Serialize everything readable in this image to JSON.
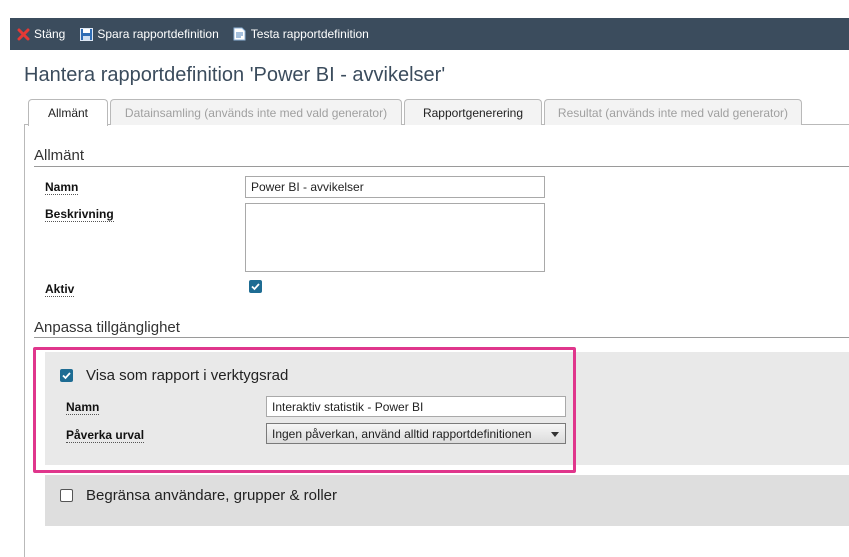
{
  "toolbar": {
    "close_label": "Stäng",
    "save_label": "Spara rapportdefinition",
    "test_label": "Testa rapportdefinition"
  },
  "page_title": "Hantera rapportdefinition 'Power BI - avvikelser'",
  "tabs": [
    {
      "label": "Allmänt",
      "state": "active"
    },
    {
      "label": "Datainsamling (används inte med vald generator)",
      "state": "disabled"
    },
    {
      "label": "Rapportgenerering",
      "state": "normal"
    },
    {
      "label": "Resultat (används inte med vald generator)",
      "state": "disabled"
    }
  ],
  "general": {
    "header": "Allmänt",
    "name_label": "Namn",
    "name_value": "Power BI - avvikelser",
    "description_label": "Beskrivning",
    "description_value": "",
    "active_label": "Aktiv",
    "active_checked": true
  },
  "availability": {
    "header": "Anpassa tillgänglighet",
    "show_as_report_label": "Visa som rapport i verktygsrad",
    "show_as_report_checked": true,
    "name_label": "Namn",
    "name_value": "Interaktiv statistik - Power BI",
    "affect_selection_label": "Påverka urval",
    "affect_selection_value": "Ingen påverkan, använd alltid rapportdefinitionen",
    "restrict_label": "Begränsa användare, grupper & roller",
    "restrict_checked": false
  },
  "colors": {
    "toolbar_bg": "#3b4c5d",
    "checkbox_checked": "#1e6c93",
    "highlight_frame": "#e0368c",
    "title_text": "#3b4c5d"
  }
}
